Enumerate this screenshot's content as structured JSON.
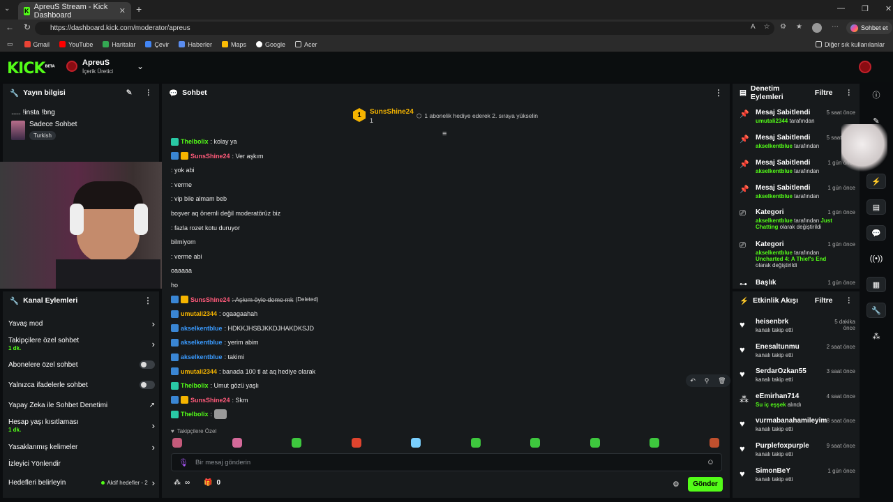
{
  "browser": {
    "tab_title": "ApreuS Stream - Kick Dashboard",
    "url": "https://dashboard.kick.com/moderator/apreus",
    "chat_button": "Sohbet et",
    "bookmarks": [
      "Gmail",
      "YouTube",
      "Haritalar",
      "Çevir",
      "Haberler",
      "Maps",
      "Google",
      "Acer"
    ],
    "other_bookmarks": "Diğer sık kullanılanlar"
  },
  "header": {
    "logo": "KICK",
    "logo_beta": "BETA",
    "channel": "ApreuS",
    "role": "İçerik Üretici"
  },
  "stream_info": {
    "title": "Yayın bilgisi",
    "stream_title": "..... !insta !bng",
    "category": "Sadece Sohbet",
    "tag": "Turkish"
  },
  "channel_actions": {
    "title": "Kanal Eylemleri",
    "items": [
      {
        "label": "Yavaş mod",
        "sub": ""
      },
      {
        "label": "Takipçilere özel sohbet",
        "sub": "1 dk."
      },
      {
        "label": "Abonelere özel sohbet",
        "sub": ""
      },
      {
        "label": "Yalnızca ifadelerle sohbet",
        "sub": ""
      },
      {
        "label": "Yapay Zeka ile Sohbet Denetimi",
        "sub": ""
      },
      {
        "label": "Hesap yaşı kısıtlaması",
        "sub": "1 dk."
      },
      {
        "label": "Yasaklanmış kelimeler",
        "sub": ""
      },
      {
        "label": "İzleyici Yönlendir",
        "sub": ""
      },
      {
        "label": "Hedefleri belirleyin",
        "sub": ""
      }
    ],
    "goals_status": "Aktif hedefler - 2"
  },
  "chat": {
    "title": "Sohbet",
    "pinned_user": "SunsShine24",
    "pinned_rank": "1",
    "pinned_count": "1",
    "pinned_text": "1 abonelik hediye ederek 2. sıraya yükselin",
    "messages": [
      {
        "user": "Thelbolix",
        "color": "#53fc18",
        "text": ": kolay ya",
        "badges": [
          "sub"
        ]
      },
      {
        "user": "SunsShine24",
        "color": "#ff5a7a",
        "text": ": Ver aşkım",
        "badges": [
          "mod",
          "vip"
        ]
      },
      {
        "user": "",
        "color": "#fff",
        "text": ": yok abi",
        "badges": []
      },
      {
        "user": "",
        "color": "#fff",
        "text": ": verme",
        "badges": []
      },
      {
        "user": "",
        "color": "#fff",
        "text": ": vip bile almam beb",
        "badges": []
      },
      {
        "user": "",
        "color": "#fff",
        "text": "boşver aq önemli değil moderatörüz biz",
        "badges": []
      },
      {
        "user": "",
        "color": "#fff",
        "text": ": fazla rozet kotu duruyor",
        "badges": []
      },
      {
        "user": "",
        "color": "#fff",
        "text": "bilmiyom",
        "badges": []
      },
      {
        "user": "",
        "color": "#fff",
        "text": ": verme abi",
        "badges": []
      },
      {
        "user": "",
        "color": "#fff",
        "text": "oaaaaa",
        "badges": []
      },
      {
        "user": "",
        "color": "#fff",
        "text": "ho",
        "badges": []
      },
      {
        "user": "SunsShine24",
        "color": "#ff5a7a",
        "text": ": Aşkım öyle deme mk",
        "deleted": "(Deleted)",
        "badges": [
          "mod",
          "vip"
        ]
      },
      {
        "user": "umutali2344",
        "color": "#f5b400",
        "text": ": ogaagaahah",
        "badges": [
          "mod"
        ]
      },
      {
        "user": "akselkentblue",
        "color": "#3a9bff",
        "text": ": HDKKJHSBJKKDJHAKDKSJD",
        "badges": [
          "mod"
        ]
      },
      {
        "user": "akselkentblue",
        "color": "#3a9bff",
        "text": ": yerim abim",
        "badges": [
          "mod"
        ]
      },
      {
        "user": "akselkentblue",
        "color": "#3a9bff",
        "text": ": takimi",
        "badges": [
          "mod"
        ]
      },
      {
        "user": "umutali2344",
        "color": "#f5b400",
        "text": ": banada 100 tl at aq hediye olarak",
        "badges": [
          "mod"
        ]
      },
      {
        "user": "Thelbolix",
        "color": "#53fc18",
        "text": ": Umut gözü yaşlı",
        "badges": [
          "sub"
        ]
      },
      {
        "user": "SunsShine24",
        "color": "#ff5a7a",
        "text": ": Skm",
        "badges": [
          "mod",
          "vip"
        ]
      },
      {
        "user": "Thelbolix",
        "color": "#53fc18",
        "text": ":",
        "badges": [
          "sub"
        ]
      }
    ],
    "followers_label": "Takipçilere Özel",
    "input_placeholder": "Bir mesaj gönderin",
    "send_label": "Gönder",
    "gift_count": "0",
    "inf": "∞"
  },
  "moderation": {
    "title": "Denetim Eylemleri",
    "filter": "Filtre",
    "items": [
      {
        "title": "Mesaj Sabitlendi",
        "by": "umutali2344",
        "suffix": "tarafından",
        "extra": "",
        "extra2": "",
        "time": "5 saat önce",
        "icon": "pin-icon"
      },
      {
        "title": "Mesaj Sabitlendi",
        "by": "akselkentblue",
        "suffix": "tarafından",
        "extra": "",
        "extra2": "",
        "time": "5 saat önce",
        "icon": "pin-icon"
      },
      {
        "title": "Mesaj Sabitlendi",
        "by": "akselkentblue",
        "suffix": "tarafından",
        "extra": "",
        "extra2": "",
        "time": "1 gün önce",
        "icon": "pin-icon"
      },
      {
        "title": "Mesaj Sabitlendi",
        "by": "akselkentblue",
        "suffix": "tarafından",
        "extra": "",
        "extra2": "",
        "time": "1 gün önce",
        "icon": "pin-icon"
      },
      {
        "title": "Kategori",
        "by": "akselkentblue",
        "suffix": "tarafından",
        "extra": "Just Chatting",
        "extra2": "olarak değiştirildi",
        "time": "1 gün önce",
        "icon": "category-icon"
      },
      {
        "title": "Kategori",
        "by": "akselkentblue",
        "suffix": "tarafından",
        "extra": "Uncharted 4: A Thief's End",
        "extra2": "olarak değiştirildi",
        "time": "1 gün önce",
        "icon": "category-icon"
      },
      {
        "title": "Başlık",
        "by": "",
        "suffix": "",
        "extra": "",
        "extra2": "",
        "time": "1 gün önce",
        "icon": "title-icon"
      }
    ]
  },
  "activity": {
    "title": "Etkinlik Akışı",
    "filter": "Filtre",
    "items": [
      {
        "user": "heisenbrk",
        "text": "kanalı takip etti",
        "time": "5 dakika önce",
        "icon": "heart-icon"
      },
      {
        "user": "Enesaltunmu",
        "text": "kanalı takip etti",
        "time": "2 saat önce",
        "icon": "heart-icon"
      },
      {
        "user": "SerdarOzkan55",
        "text": "kanalı takip etti",
        "time": "3 saat önce",
        "icon": "heart-icon"
      },
      {
        "user": "eEmirhan714",
        "text": "Su iç eşşek",
        "text2": "alındı",
        "time": "4 saat önce",
        "icon": "points-icon"
      },
      {
        "user": "vurmabanahamileyim",
        "text": "kanalı takip etti",
        "time": "8 saat önce",
        "icon": "heart-icon"
      },
      {
        "user": "Purplefoxpurple",
        "text": "kanalı takip etti",
        "time": "9 saat önce",
        "icon": "heart-icon"
      },
      {
        "user": "SimonBeY",
        "text": "kanalı takip etti",
        "time": "1 gün önce",
        "icon": "heart-icon"
      }
    ]
  }
}
